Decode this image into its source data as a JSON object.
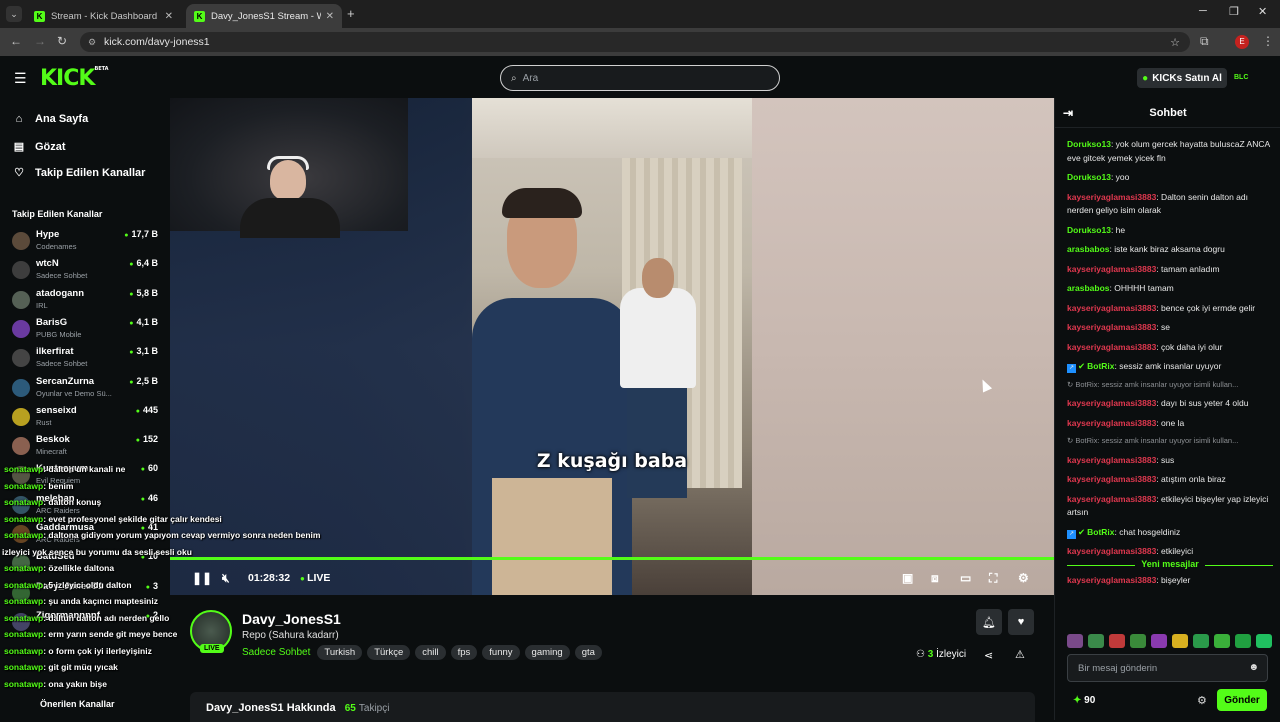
{
  "browser": {
    "tabs": [
      {
        "title": "Stream - Kick Dashboard"
      },
      {
        "title": "Davy_JonesS1 Stream - Wa"
      }
    ],
    "url": "kick.com/davy-joness1",
    "profile_initial": "E"
  },
  "header": {
    "logo": "KICK",
    "logo_badge": "BETA",
    "search_placeholder": "Ara",
    "kicks_button": "KICKs Satın Al",
    "kicks_badge": "BLC"
  },
  "sidebar": {
    "nav": [
      {
        "label": "Ana Sayfa",
        "icon": "home-icon"
      },
      {
        "label": "Gözat",
        "icon": "browse-icon"
      },
      {
        "label": "Takip Edilen Kanallar",
        "icon": "heart-icon"
      }
    ],
    "section_title": "Takip Edilen Kanallar",
    "channels": [
      {
        "name": "Hype",
        "sub": "Codenames",
        "count": "17,7 B",
        "color": "#5b4a3a"
      },
      {
        "name": "wtcN",
        "sub": "Sadece Sohbet",
        "count": "6,4 B",
        "color": "#3d3d3d"
      },
      {
        "name": "atadogann",
        "sub": "IRL",
        "count": "5,8 B",
        "color": "#556055"
      },
      {
        "name": "BarisG",
        "sub": "PUBG Mobile",
        "count": "4,1 B",
        "color": "#6a3aa0"
      },
      {
        "name": "ilkerfirat",
        "sub": "Sadece Sohbet",
        "count": "3,1 B",
        "color": "#444"
      },
      {
        "name": "SercanZurna",
        "sub": "Oyunlar ve Demo Sü...",
        "count": "2,5 B",
        "color": "#2c5a7a"
      },
      {
        "name": "senseixd",
        "sub": "Rust",
        "count": "445",
        "color": "#b8a020"
      },
      {
        "name": "Beskok",
        "sub": "Minecraft",
        "count": "152",
        "color": "#8a6050"
      },
      {
        "name": "Kuntsoyum",
        "sub": "Evil Requiem",
        "count": "60",
        "color": "#554"
      },
      {
        "name": "melehan",
        "sub": "ARC Raiders",
        "count": "46",
        "color": "#356"
      },
      {
        "name": "Gaddarmusa",
        "sub": "ARC Raiders",
        "count": "41",
        "color": "#642"
      },
      {
        "name": "BatuSed",
        "sub": "",
        "count": "10",
        "color": "#464"
      },
      {
        "name": "Davy_JonesS1",
        "sub": "",
        "count": "3",
        "color": "#363"
      },
      {
        "name": "Zigormannnnf",
        "sub": "",
        "count": "2",
        "color": "#446"
      }
    ],
    "recommended_title": "Önerilen Kanallar"
  },
  "player": {
    "subtitle": "Z kuşağı baba",
    "time": "01:28:32",
    "live_label": "LIVE"
  },
  "stream_info": {
    "streamer": "Davy_JonesS1",
    "live_badge": "LIVE",
    "title": "Repo (Sahura kadarr)",
    "category": "Sadece Sohbet",
    "tags": [
      "Turkish",
      "Türkçe",
      "chill",
      "fps",
      "funny",
      "gaming",
      "gta"
    ],
    "viewer_count": "3",
    "viewer_label": "İzleyici",
    "about_title": "Davy_JonesS1 Hakkında",
    "followers_count": "65",
    "followers_label": "Takipçi"
  },
  "chat": {
    "title": "Sohbet",
    "messages": [
      {
        "user": "Dorukso13",
        "color": "#53fc18",
        "text": ": yok olum gercek hayatta buluscaZ ANCA eve gitcek yemek yicek fln"
      },
      {
        "user": "Dorukso13",
        "color": "#53fc18",
        "text": ": yoo"
      },
      {
        "user": "kayseriyaglamasi3883",
        "color": "#e0384f",
        "text": ": Dalton senin dalton adı nerden geliyo isim olarak"
      },
      {
        "user": "Dorukso13",
        "color": "#53fc18",
        "text": ": he"
      },
      {
        "user": "arasbabos",
        "color": "#53fc18",
        "text": ": iste kank biraz aksama dogru"
      },
      {
        "user": "kayseriyaglamasi3883",
        "color": "#e0384f",
        "text": ": tamam anladım"
      },
      {
        "user": "arasbabos",
        "color": "#53fc18",
        "text": ": OHHHH tamam"
      },
      {
        "user": "kayseriyaglamasi3883",
        "color": "#e0384f",
        "text": ": bence çok iyi ermde gelir"
      },
      {
        "user": "kayseriyaglamasi3883",
        "color": "#e0384f",
        "text": ": se"
      },
      {
        "user": "kayseriyaglamasi3883",
        "color": "#e0384f",
        "text": ": çok daha iyi olur"
      },
      {
        "user": "BotRix",
        "color": "#53fc18",
        "text": ": sessiz amk insanlar uyuyor",
        "bot": true
      },
      {
        "system": "BotRix: sessiz amk insanlar uyuyor isimli kullan..."
      },
      {
        "user": "kayseriyaglamasi3883",
        "color": "#e0384f",
        "text": ": dayı bi sus yeter 4 oldu"
      },
      {
        "user": "kayseriyaglamasi3883",
        "color": "#e0384f",
        "text": ": one la"
      },
      {
        "system": "BotRix: sessiz amk insanlar uyuyor isimli kullan..."
      },
      {
        "user": "kayseriyaglamasi3883",
        "color": "#e0384f",
        "text": ": sus"
      },
      {
        "user": "kayseriyaglamasi3883",
        "color": "#e0384f",
        "text": ": atıştım onla biraz"
      },
      {
        "user": "kayseriyaglamasi3883",
        "color": "#e0384f",
        "text": ": etkileyici bişeyler yap izleyici artsın"
      },
      {
        "user": "BotRix",
        "color": "#53fc18",
        "text": ": chat hosgeldiniz",
        "bot": true
      },
      {
        "user": "kayseriyaglamasi3883",
        "color": "#e0384f",
        "text": ": etkileyici"
      }
    ],
    "new_messages_label": "Yeni mesajlar",
    "after_new": [
      {
        "user": "kayseriyaglamasi3883",
        "color": "#e0384f",
        "text": ": bişeyler"
      }
    ],
    "input_placeholder": "Bir mesaj gönderin",
    "kicks_balance": "90",
    "send_label": "Gönder"
  },
  "overlay_chat": [
    {
      "user": "sonatawp",
      "text": ": dalton un kanali ne"
    },
    {
      "user": "sonatawp",
      "text": ": benim"
    },
    {
      "user": "sonatawp",
      "text": ": dalton konuş"
    },
    {
      "user": "sonatawp",
      "text": ": evet profesyonel şekilde gitar çalır kendesi"
    },
    {
      "user": "sonatawp",
      "text": ": daltona gidiyom yorum yapıyom cevap vermiyo sonra neden benim"
    },
    {
      "user": "",
      "text": "izleyici yok sence bu yorumu da sesli sesli oku"
    },
    {
      "user": "sonatawp",
      "text": ": özellikle daltona"
    },
    {
      "user": "sonatawp",
      "text": ": 5 izleyici oldu dalton"
    },
    {
      "user": "sonatawp",
      "text": ": şu anda kaçıncı maptesiniz"
    },
    {
      "user": "sonatawp",
      "text": ": daltun dalton adı nerden gello"
    },
    {
      "user": "sonatawp",
      "text": ": erm yarın sende git meye bence"
    },
    {
      "user": "sonatawp",
      "text": ": o form çok iyi ilerleyişiniz"
    },
    {
      "user": "sonatawp",
      "text": ": git git müq ıyıcak"
    },
    {
      "user": "sonatawp",
      "text": ": ona yakın bişe"
    }
  ]
}
